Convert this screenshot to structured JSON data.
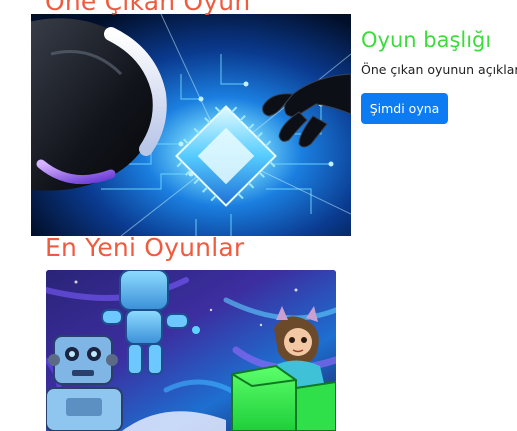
{
  "featured": {
    "heading": "Öne Çıkan Oyun",
    "game_title": "Oyun başlığı",
    "game_description": "Öne çıkan oyunun açıklaması",
    "play_button_label": "Şimdi oyna"
  },
  "newest": {
    "heading": "En Yeni Oyunlar"
  },
  "colors": {
    "heading": "#ef5b3f",
    "game_title": "#3ddc3d",
    "button": "#0d7cf2"
  }
}
